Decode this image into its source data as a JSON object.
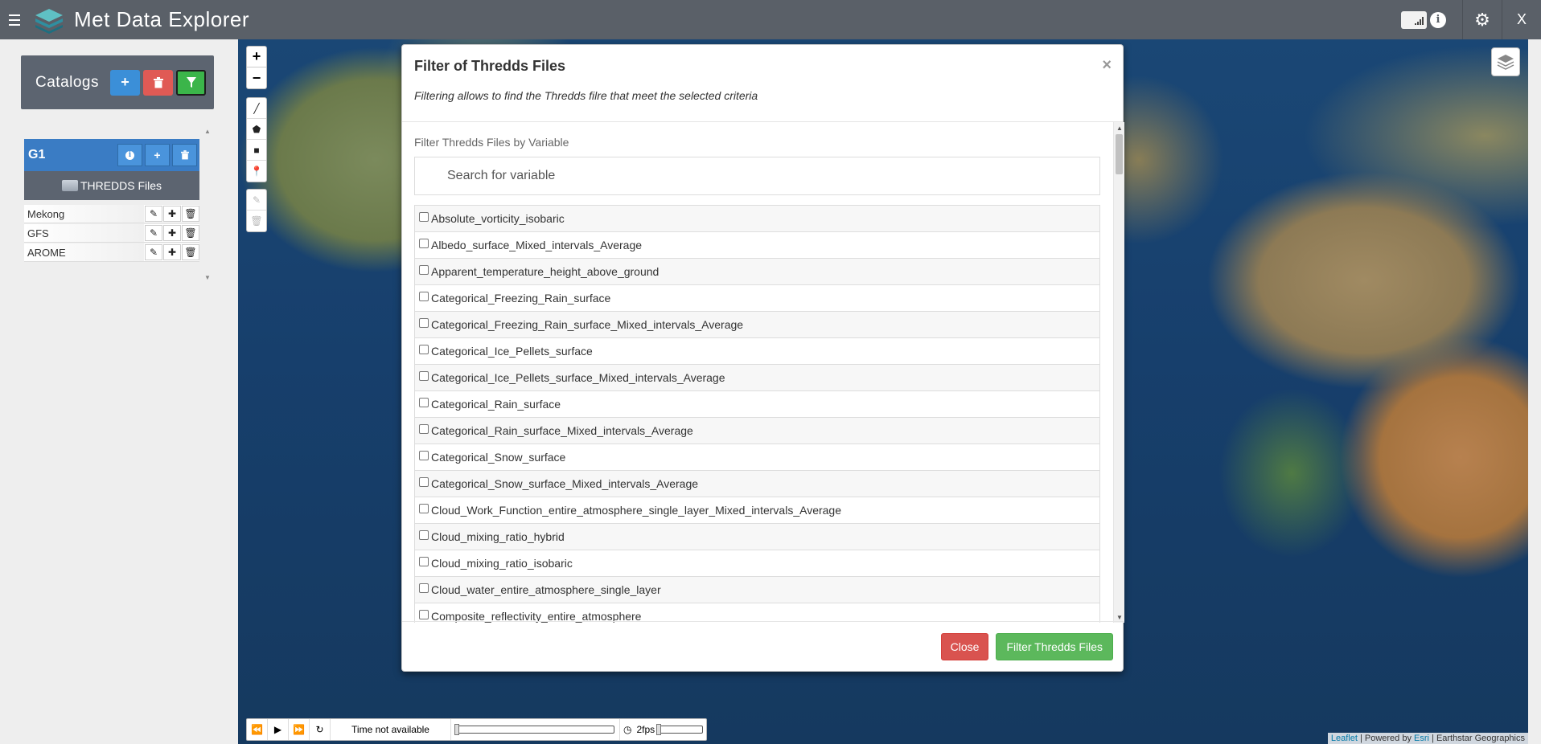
{
  "header": {
    "title": "Met Data Explorer",
    "close_label": "X"
  },
  "sidebar": {
    "catalogs_label": "Catalogs",
    "group": {
      "name": "G1",
      "files_label": "THREDDS Files",
      "items": [
        {
          "label": "Mekong"
        },
        {
          "label": "GFS"
        },
        {
          "label": "AROME"
        }
      ]
    }
  },
  "map": {
    "time_text": "Time not available",
    "fps_label": "2fps",
    "attribution": {
      "leaflet": "Leaflet",
      "powered": " | Powered by ",
      "esri": "Esri",
      "source": " | Earthstar Geographics"
    }
  },
  "modal": {
    "title": "Filter of Thredds Files",
    "subtitle": "Filtering allows to find the Thredds filre that meet the selected criteria",
    "filter_label": "Filter Thredds Files by Variable",
    "search_placeholder": "Search for variable",
    "variables": [
      "Absolute_vorticity_isobaric",
      "Albedo_surface_Mixed_intervals_Average",
      "Apparent_temperature_height_above_ground",
      "Categorical_Freezing_Rain_surface",
      "Categorical_Freezing_Rain_surface_Mixed_intervals_Average",
      "Categorical_Ice_Pellets_surface",
      "Categorical_Ice_Pellets_surface_Mixed_intervals_Average",
      "Categorical_Rain_surface",
      "Categorical_Rain_surface_Mixed_intervals_Average",
      "Categorical_Snow_surface",
      "Categorical_Snow_surface_Mixed_intervals_Average",
      "Cloud_Work_Function_entire_atmosphere_single_layer_Mixed_intervals_Average",
      "Cloud_mixing_ratio_hybrid",
      "Cloud_mixing_ratio_isobaric",
      "Cloud_water_entire_atmosphere_single_layer",
      "Composite_reflectivity_entire_atmosphere"
    ],
    "close_button": "Close",
    "filter_button": "Filter Thredds Files"
  },
  "colors": {
    "topbar": "#5a6068",
    "primary": "#3b8fd8",
    "danger": "#d9534f",
    "success": "#5cb85c"
  }
}
